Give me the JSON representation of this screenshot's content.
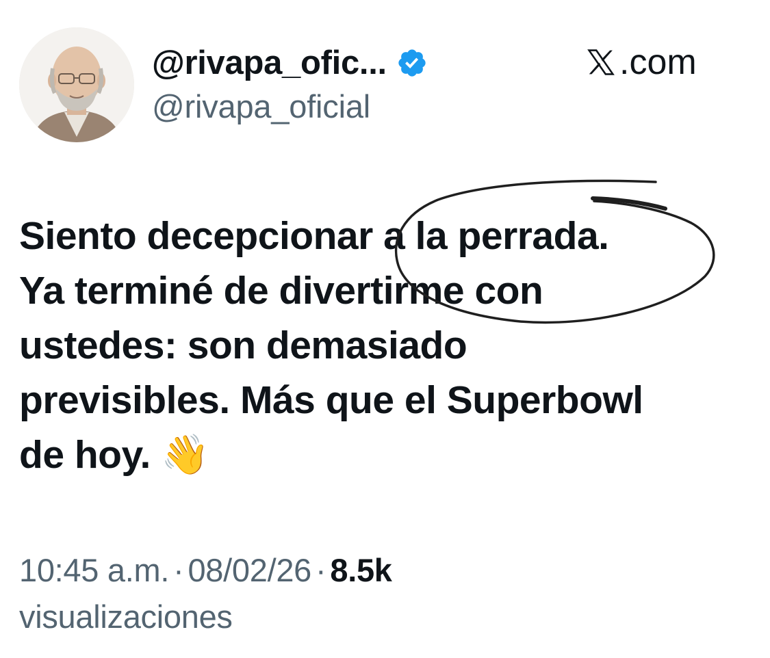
{
  "author": {
    "display_name": "@rivapa_ofic...",
    "handle": "@rivapa_oficial",
    "verified_icon": "verified-badge-icon",
    "avatar": "profile-photo"
  },
  "brand": {
    "icon": "x-logo-icon",
    "label": ".com"
  },
  "tweet": {
    "lines": [
      "Siento decepcionar a la perrada.",
      "Ya terminé de divertirme con",
      "ustedes: son demasiado",
      "previsibles. Más que el Superbowl",
      "de hoy."
    ],
    "emoji": "👋",
    "annotation": "hand-drawn-circle"
  },
  "meta": {
    "time": "10:45 a.m.",
    "separator": "·",
    "date": "08/02/26",
    "views_count": "8.5k",
    "views_label": "visualizaciones"
  },
  "colors": {
    "primary_text": "#0f1419",
    "secondary_text": "#536471",
    "verified_blue": "#1d9bf0",
    "background": "#ffffff"
  }
}
